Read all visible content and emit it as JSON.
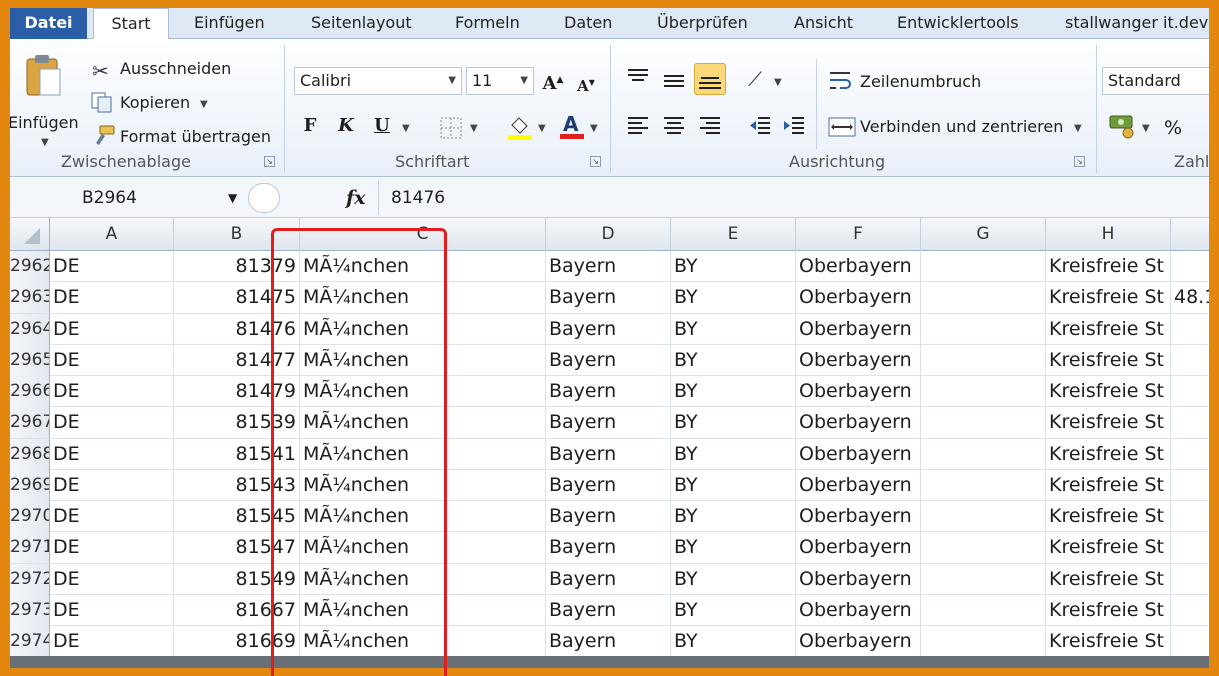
{
  "tabs": {
    "file": "Datei",
    "items": [
      "Start",
      "Einfügen",
      "Seitenlayout",
      "Formeln",
      "Daten",
      "Überprüfen",
      "Ansicht",
      "Entwicklertools",
      "stallwanger it.dev"
    ]
  },
  "clipboard": {
    "paste": "Einfügen",
    "cut": "Ausschneiden",
    "copy": "Kopieren",
    "format_painter": "Format übertragen",
    "group_label": "Zwischenablage"
  },
  "font": {
    "name": "Calibri",
    "size": "11",
    "bold": "F",
    "italic": "K",
    "underline": "U",
    "group_label": "Schriftart"
  },
  "alignment": {
    "wrap_text": "Zeilenumbruch",
    "merge_center": "Verbinden und zentrieren",
    "group_label": "Ausrichtung"
  },
  "number": {
    "format": "Standard",
    "percent": "%",
    "group_label": "Zahl"
  },
  "formula_bar": {
    "name_box": "B2964",
    "fx": "fx",
    "value": "81476"
  },
  "columns": [
    "A",
    "B",
    "C",
    "D",
    "E",
    "F",
    "G",
    "H"
  ],
  "rows": [
    {
      "num": "2962",
      "a": "DE",
      "b": "81379",
      "c": "MÃ¼nchen",
      "d": "Bayern",
      "e": "BY",
      "f": "Oberbayern",
      "g": "",
      "h": "Kreisfreie St",
      "i": ""
    },
    {
      "num": "2963",
      "a": "DE",
      "b": "81475",
      "c": "MÃ¼nchen",
      "d": "Bayern",
      "e": "BY",
      "f": "Oberbayern",
      "g": "",
      "h": "Kreisfreie St",
      "i": "48.1"
    },
    {
      "num": "2964",
      "a": "DE",
      "b": "81476",
      "c": "MÃ¼nchen",
      "d": "Bayern",
      "e": "BY",
      "f": "Oberbayern",
      "g": "",
      "h": "Kreisfreie St",
      "i": ""
    },
    {
      "num": "2965",
      "a": "DE",
      "b": "81477",
      "c": "MÃ¼nchen",
      "d": "Bayern",
      "e": "BY",
      "f": "Oberbayern",
      "g": "",
      "h": "Kreisfreie St",
      "i": ""
    },
    {
      "num": "2966",
      "a": "DE",
      "b": "81479",
      "c": "MÃ¼nchen",
      "d": "Bayern",
      "e": "BY",
      "f": "Oberbayern",
      "g": "",
      "h": "Kreisfreie St",
      "i": ""
    },
    {
      "num": "2967",
      "a": "DE",
      "b": "81539",
      "c": "MÃ¼nchen",
      "d": "Bayern",
      "e": "BY",
      "f": "Oberbayern",
      "g": "",
      "h": "Kreisfreie St",
      "i": ""
    },
    {
      "num": "2968",
      "a": "DE",
      "b": "81541",
      "c": "MÃ¼nchen",
      "d": "Bayern",
      "e": "BY",
      "f": "Oberbayern",
      "g": "",
      "h": "Kreisfreie St",
      "i": ""
    },
    {
      "num": "2969",
      "a": "DE",
      "b": "81543",
      "c": "MÃ¼nchen",
      "d": "Bayern",
      "e": "BY",
      "f": "Oberbayern",
      "g": "",
      "h": "Kreisfreie St",
      "i": ""
    },
    {
      "num": "2970",
      "a": "DE",
      "b": "81545",
      "c": "MÃ¼nchen",
      "d": "Bayern",
      "e": "BY",
      "f": "Oberbayern",
      "g": "",
      "h": "Kreisfreie St",
      "i": ""
    },
    {
      "num": "2971",
      "a": "DE",
      "b": "81547",
      "c": "MÃ¼nchen",
      "d": "Bayern",
      "e": "BY",
      "f": "Oberbayern",
      "g": "",
      "h": "Kreisfreie St",
      "i": ""
    },
    {
      "num": "2972",
      "a": "DE",
      "b": "81549",
      "c": "MÃ¼nchen",
      "d": "Bayern",
      "e": "BY",
      "f": "Oberbayern",
      "g": "",
      "h": "Kreisfreie St",
      "i": ""
    },
    {
      "num": "2973",
      "a": "DE",
      "b": "81667",
      "c": "MÃ¼nchen",
      "d": "Bayern",
      "e": "BY",
      "f": "Oberbayern",
      "g": "",
      "h": "Kreisfreie St",
      "i": ""
    },
    {
      "num": "2974",
      "a": "DE",
      "b": "81669",
      "c": "MÃ¼nchen",
      "d": "Bayern",
      "e": "BY",
      "f": "Oberbayern",
      "g": "",
      "h": "Kreisfreie St",
      "i": ""
    }
  ],
  "colors": {
    "frame": "#e4870f",
    "file_tab": "#2a5fa8",
    "highlight": "#e01e1e"
  }
}
